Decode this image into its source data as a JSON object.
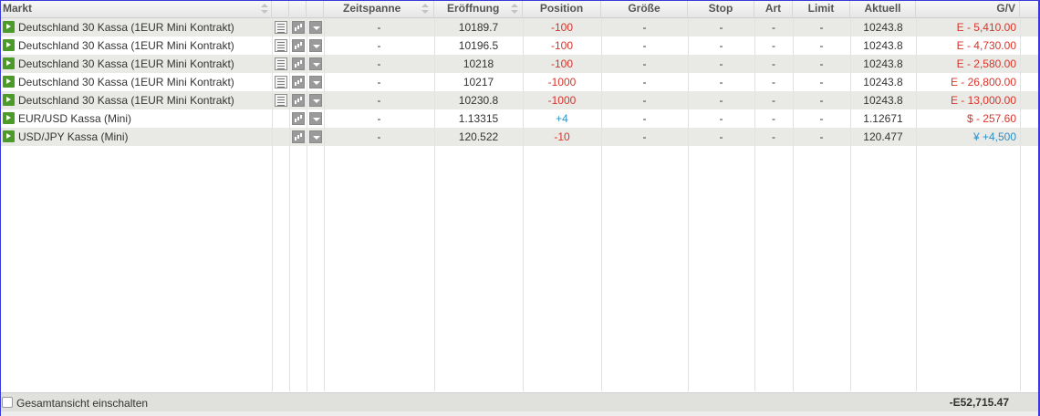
{
  "columns": {
    "markt": "Markt",
    "zeitspanne": "Zeitspanne",
    "eroeffnung": "Eröffnung",
    "position": "Position",
    "groesse": "Größe",
    "stop": "Stop",
    "art": "Art",
    "limit": "Limit",
    "aktuell": "Aktuell",
    "gv": "G/V"
  },
  "rows": [
    {
      "markt": "Deutschland 30 Kassa (1EUR Mini Kontrakt)",
      "has_doc": true,
      "zeitspanne": "-",
      "eroeffnung": "10189.7",
      "position": "-100",
      "position_sign": "neg",
      "groesse": "-",
      "stop": "-",
      "art": "-",
      "limit": "-",
      "aktuell": "10243.8",
      "gv": "E - 5,410.00",
      "gv_sign": "neg"
    },
    {
      "markt": "Deutschland 30 Kassa (1EUR Mini Kontrakt)",
      "has_doc": true,
      "zeitspanne": "-",
      "eroeffnung": "10196.5",
      "position": "-100",
      "position_sign": "neg",
      "groesse": "-",
      "stop": "-",
      "art": "-",
      "limit": "-",
      "aktuell": "10243.8",
      "gv": "E - 4,730.00",
      "gv_sign": "neg"
    },
    {
      "markt": "Deutschland 30 Kassa (1EUR Mini Kontrakt)",
      "has_doc": true,
      "zeitspanne": "-",
      "eroeffnung": "10218",
      "position": "-100",
      "position_sign": "neg",
      "groesse": "-",
      "stop": "-",
      "art": "-",
      "limit": "-",
      "aktuell": "10243.8",
      "gv": "E - 2,580.00",
      "gv_sign": "neg"
    },
    {
      "markt": "Deutschland 30 Kassa (1EUR Mini Kontrakt)",
      "has_doc": true,
      "zeitspanne": "-",
      "eroeffnung": "10217",
      "position": "-1000",
      "position_sign": "neg",
      "groesse": "-",
      "stop": "-",
      "art": "-",
      "limit": "-",
      "aktuell": "10243.8",
      "gv": "E - 26,800.00",
      "gv_sign": "neg"
    },
    {
      "markt": "Deutschland 30 Kassa (1EUR Mini Kontrakt)",
      "has_doc": true,
      "zeitspanne": "-",
      "eroeffnung": "10230.8",
      "position": "-1000",
      "position_sign": "neg",
      "groesse": "-",
      "stop": "-",
      "art": "-",
      "limit": "-",
      "aktuell": "10243.8",
      "gv": "E - 13,000.00",
      "gv_sign": "neg"
    },
    {
      "markt": "EUR/USD Kassa (Mini)",
      "has_doc": false,
      "zeitspanne": "-",
      "eroeffnung": "1.13315",
      "position": "+4",
      "position_sign": "pos",
      "groesse": "-",
      "stop": "-",
      "art": "-",
      "limit": "-",
      "aktuell": "1.12671",
      "gv": "$ - 257.60",
      "gv_sign": "neg"
    },
    {
      "markt": "USD/JPY Kassa (Mini)",
      "has_doc": false,
      "zeitspanne": "-",
      "eroeffnung": "120.522",
      "position": "-10",
      "position_sign": "neg",
      "groesse": "-",
      "stop": "-",
      "art": "-",
      "limit": "-",
      "aktuell": "120.477",
      "gv": "¥ +4,500",
      "gv_sign": "pos"
    }
  ],
  "footer": {
    "toggle_label": "Gesamtansicht einschalten",
    "total": "-E52,715.47"
  },
  "colors": {
    "negative": "#d9342b",
    "positive": "#2d8fc7",
    "play_icon": "#4c9a2a",
    "row_alt": "#e9e9e5"
  },
  "icons": [
    "play-icon",
    "details-icon",
    "chart-icon",
    "dropdown-icon",
    "sort-icon"
  ]
}
